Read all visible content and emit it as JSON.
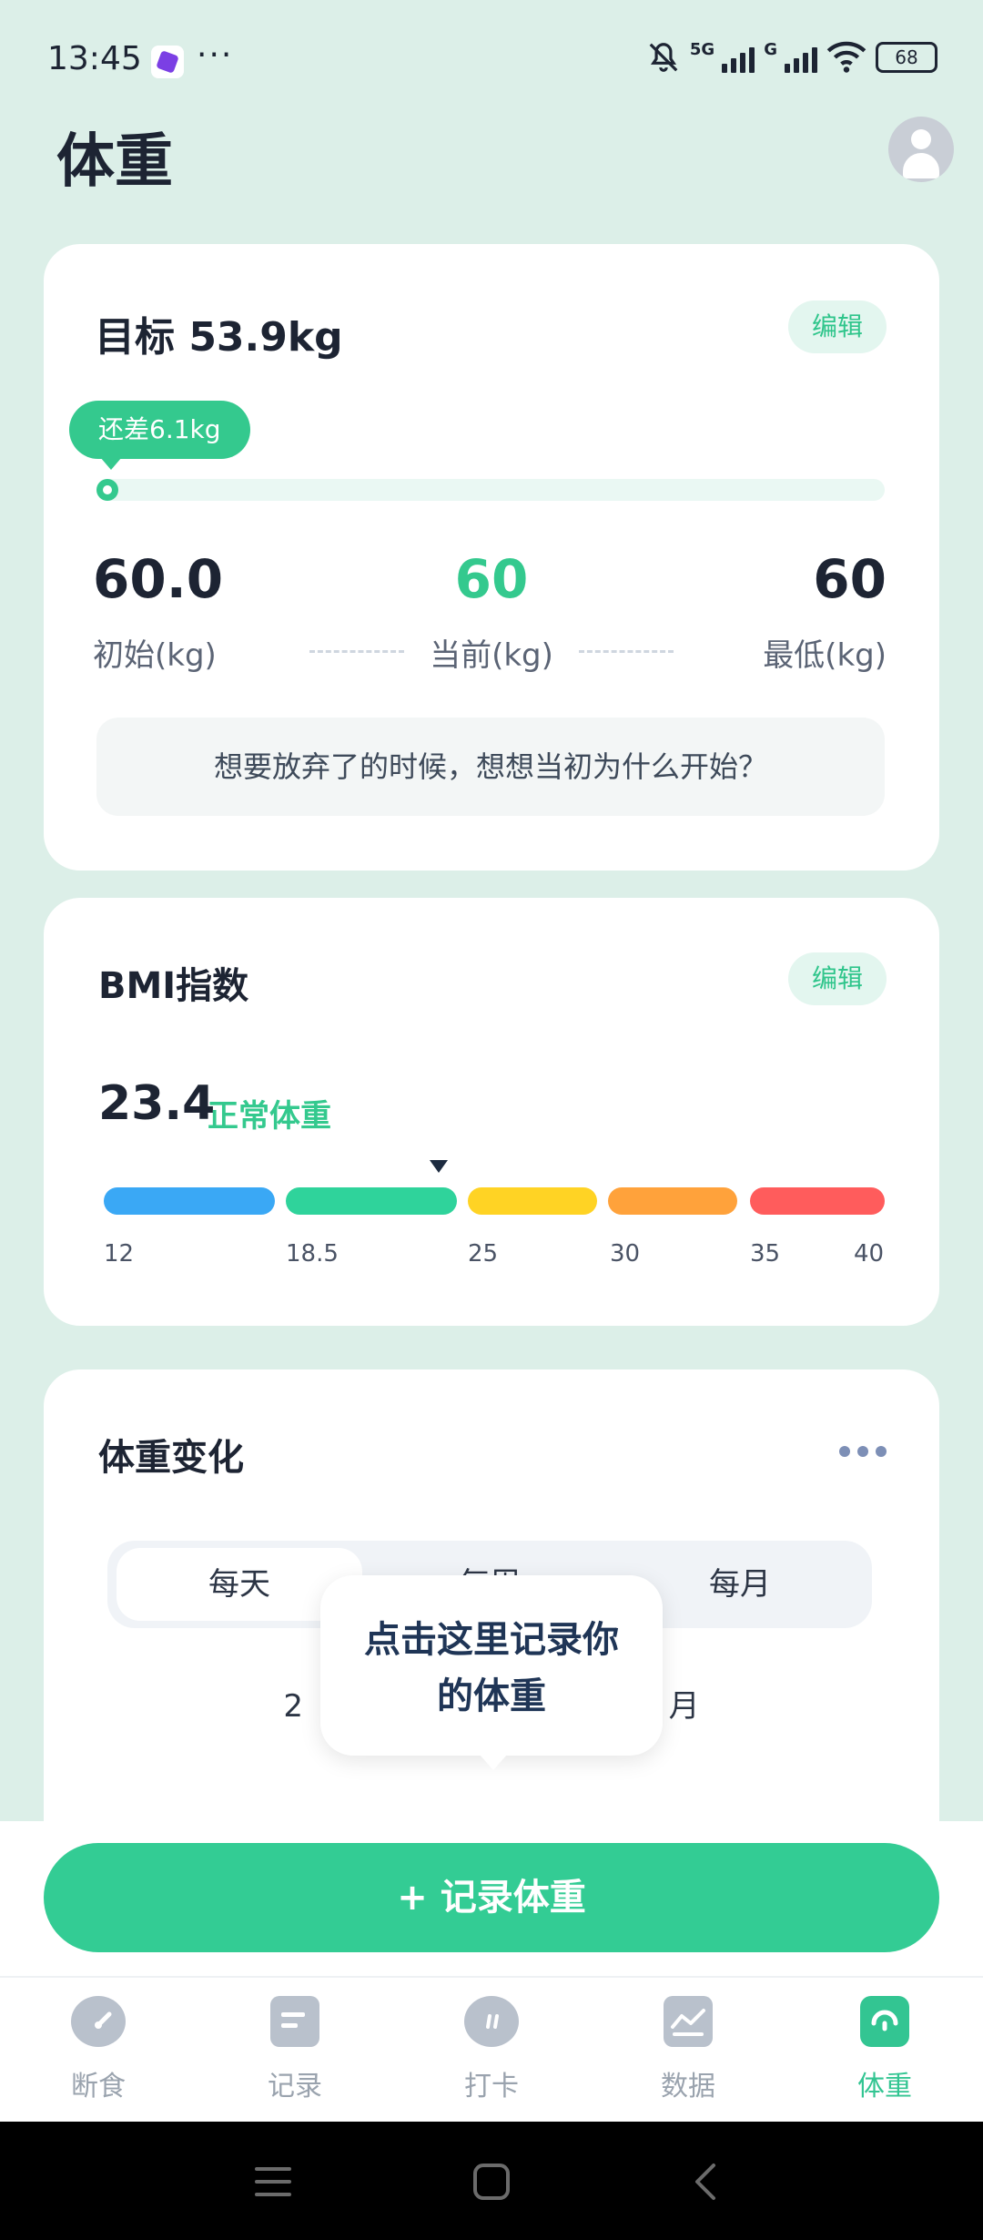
{
  "status_bar": {
    "time": "13:45",
    "more": "···",
    "net1": "5G",
    "net2": "G",
    "battery": "68"
  },
  "header": {
    "title": "体重"
  },
  "goal": {
    "title": "目标 53.9kg",
    "edit": "编辑",
    "remaining": "还差6.1kg",
    "progress": 0,
    "initial_value": "60.0",
    "initial_label": "初始(kg)",
    "current_value": "60",
    "current_label": "当前(kg)",
    "lowest_value": "60",
    "lowest_label": "最低(kg)",
    "quote": "想要放弃了的时候，想想当初为什么开始？"
  },
  "bmi": {
    "title": "BMI指数",
    "edit": "编辑",
    "value": "23.4",
    "status": "正常体重",
    "ticks": [
      "12",
      "18.5",
      "25",
      "30",
      "35",
      "40"
    ],
    "segment_colors": [
      "#3aa8f5",
      "#2fd39b",
      "#ffd324",
      "#ffa23b",
      "#ff5c5c"
    ]
  },
  "trend": {
    "title": "体重变化",
    "tabs": [
      "每天",
      "每周",
      "每月"
    ],
    "active_tab": "每天",
    "date_range_start": "2",
    "date_range_end": "月"
  },
  "tooltip": {
    "line1": "点击这里记录你",
    "line2": "的体重"
  },
  "record_button": {
    "label": "+  记录体重"
  },
  "tabbar": {
    "items": [
      {
        "label": "断食",
        "icon": "gauge-icon"
      },
      {
        "label": "记录",
        "icon": "note-icon"
      },
      {
        "label": "打卡",
        "icon": "chat-icon"
      },
      {
        "label": "数据",
        "icon": "chart-icon"
      },
      {
        "label": "体重",
        "icon": "scale-icon"
      }
    ],
    "active": "体重"
  },
  "colors": {
    "accent": "#33cc94",
    "background": "#dcefe8"
  }
}
